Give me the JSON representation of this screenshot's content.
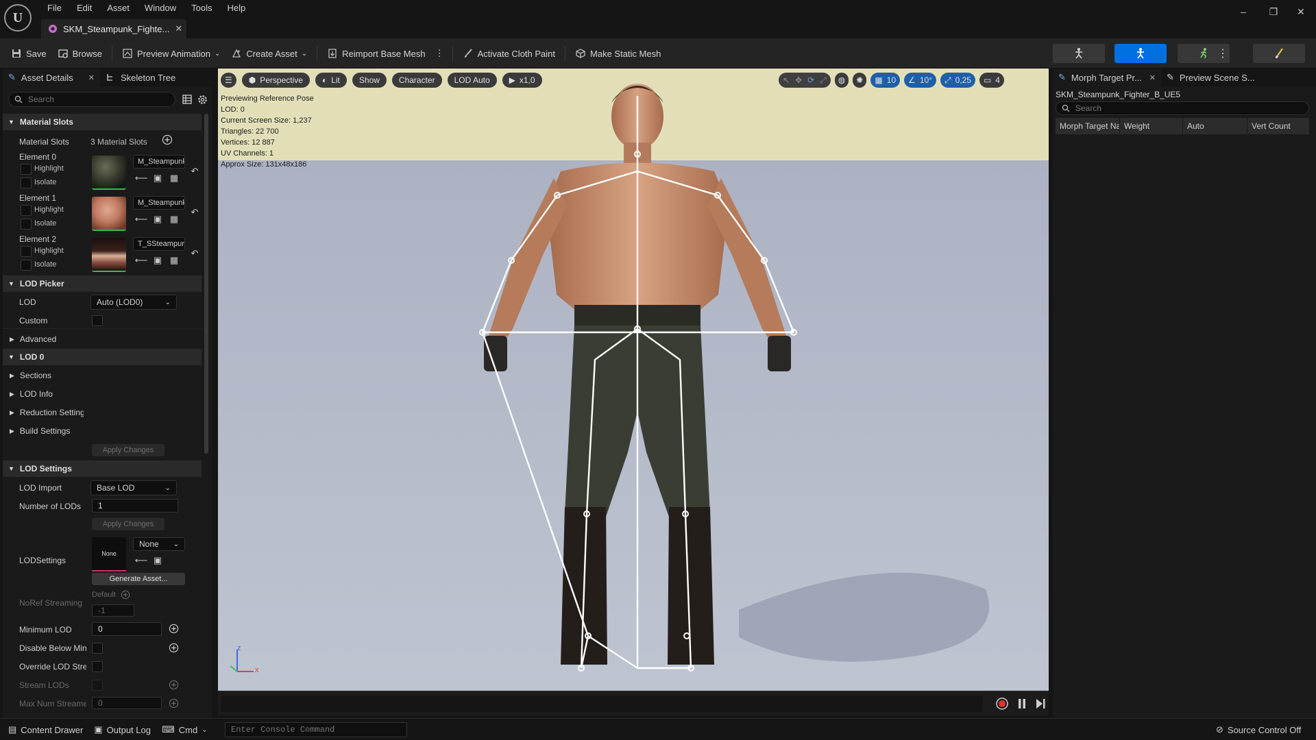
{
  "app": {
    "logo_text": "U",
    "menu": [
      "File",
      "Edit",
      "Asset",
      "Window",
      "Tools",
      "Help"
    ],
    "doc_tab": "SKM_Steampunk_Fighte..."
  },
  "toolbar": {
    "save": "Save",
    "browse": "Browse",
    "preview_animation": "Preview Animation",
    "create_asset": "Create Asset",
    "reimport": "Reimport Base Mesh",
    "cloth_paint": "Activate Cloth Paint",
    "static_mesh": "Make Static Mesh"
  },
  "left_panel": {
    "tab_details": "Asset Details",
    "tab_skeleton": "Skeleton Tree",
    "search_placeholder": "Search",
    "material_slots": {
      "header": "Material Slots",
      "label": "Material Slots",
      "count": "3 Material Slots",
      "elements": [
        {
          "name": "Element 0",
          "material": "M_Steampunk",
          "highlight": "Highlight",
          "isolate": "Isolate"
        },
        {
          "name": "Element 1",
          "material": "M_Steampunk",
          "highlight": "Highlight",
          "isolate": "Isolate"
        },
        {
          "name": "Element 2",
          "material": "T_SSteampun",
          "highlight": "Highlight",
          "isolate": "Isolate"
        }
      ]
    },
    "lod_picker": {
      "header": "LOD Picker",
      "lod_label": "LOD",
      "lod_value": "Auto (LOD0)",
      "custom_label": "Custom",
      "advanced": "Advanced"
    },
    "lod0": {
      "header": "LOD 0",
      "sections": "Sections",
      "lod_info": "LOD Info",
      "reduction": "Reduction Settings",
      "build": "Build Settings",
      "apply": "Apply Changes"
    },
    "lod_settings": {
      "header": "LOD Settings",
      "import_label": "LOD Import",
      "import_value": "Base LOD",
      "num_lods_label": "Number of LODs",
      "num_lods_value": "1",
      "apply": "Apply Changes",
      "lodsettings_label": "LODSettings",
      "lodsettings_thumb": "None",
      "lodsettings_value": "None",
      "generate": "Generate Asset...",
      "noref_label": "NoRef Streaming LOD Bias",
      "noref_default": "Default",
      "noref_value": "-1",
      "min_lod_label": "Minimum LOD",
      "min_lod_value": "0",
      "disable_below_label": "Disable Below Min LOD Stripping",
      "override_label": "Override LOD Streaming Settings",
      "stream_lods_label": "Stream LODs",
      "max_num_label": "Max Num Streamed LODs",
      "max_num_value": "0"
    }
  },
  "viewport": {
    "perspective": "Perspective",
    "lit": "Lit",
    "show": "Show",
    "character": "Character",
    "lod_auto": "LOD Auto",
    "play_speed": "x1,0",
    "grid_value": "10",
    "angle_value": "10°",
    "scale_value": "0,25",
    "camera_speed": "4",
    "stats": [
      "Previewing Reference Pose",
      "LOD: 0",
      "Current Screen Size: 1,237",
      "Triangles: 22 700",
      "Vertices: 12 887",
      "UV Channels: 1",
      "Approx Size: 131x48x186"
    ],
    "axis_x": "x",
    "axis_z": "z"
  },
  "right_panel": {
    "tab_morph": "Morph Target Pr...",
    "tab_preview": "Preview Scene S...",
    "mesh_name": "SKM_Steampunk_Fighter_B_UE5",
    "search_placeholder": "Search",
    "columns": [
      "Morph Target Name",
      "Weight",
      "Auto",
      "Vert Count"
    ]
  },
  "statusbar": {
    "content_drawer": "Content Drawer",
    "output_log": "Output Log",
    "cmd": "Cmd",
    "console_placeholder": "Enter Console Command",
    "source_control": "Source Control Off"
  },
  "colors": {
    "accent": "#0070e0",
    "panel": "#1a1a1a",
    "sky_top": "#e2dfb8",
    "floor": "#b3b9c8"
  }
}
